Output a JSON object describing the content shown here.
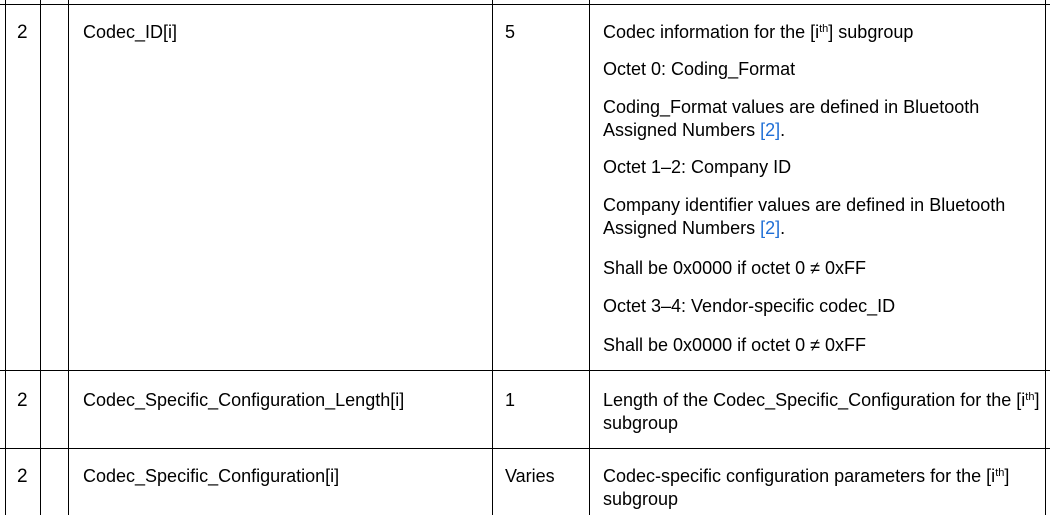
{
  "rows": [
    {
      "level": "2",
      "name": "Codec_ID[i]",
      "size": "5",
      "desc": [
        {
          "pre": "Codec information for the [i",
          "sup": "th",
          "post": "] subgroup"
        },
        {
          "text": "Octet 0: Coding_Format"
        },
        {
          "text": "Coding_Format values are defined in Bluetooth Assigned Numbers ",
          "ref": "[2]",
          "tail": "."
        },
        {
          "text": "Octet 1–2: Company ID"
        },
        {
          "text": "Company identifier values are defined in Bluetooth Assigned Numbers ",
          "ref": "[2]",
          "tail": "."
        },
        {
          "text": "Shall be 0x0000 if octet 0 ≠ 0xFF"
        },
        {
          "text": "Octet 3–4: Vendor-specific codec_ID"
        },
        {
          "text": "Shall be 0x0000 if octet 0 ≠ 0xFF"
        }
      ]
    },
    {
      "level": "2",
      "name": "Codec_Specific_Configuration_Length[i]",
      "size": "1",
      "desc": [
        {
          "pre": "Length of the Codec_Specific_Configuration for the [i",
          "sup": "th",
          "post": "] subgroup"
        }
      ]
    },
    {
      "level": "2",
      "name": "Codec_Specific_Configuration[i]",
      "size": "Varies",
      "desc": [
        {
          "pre": "Codec-specific configuration parameters for the [i",
          "sup": "th",
          "post": "] subgroup"
        }
      ]
    }
  ]
}
